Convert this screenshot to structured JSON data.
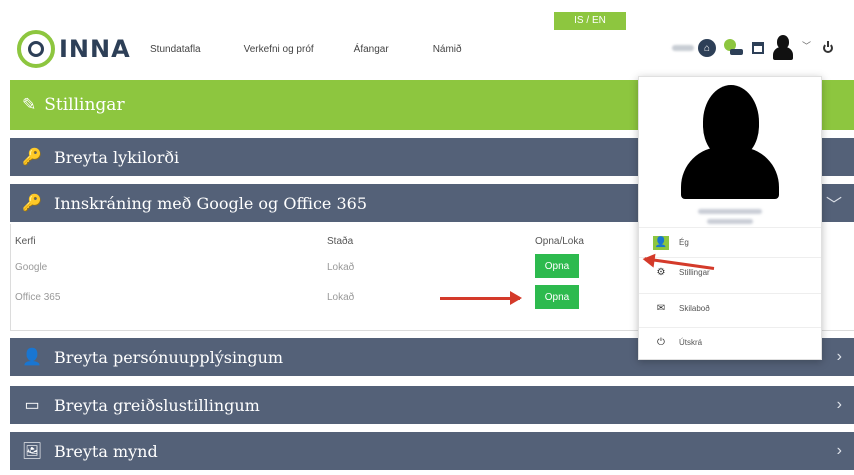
{
  "header": {
    "lang_toggle": "IS / EN",
    "logo_text": "INNA",
    "nav": [
      "Stundatafla",
      "Verkefni og próf",
      "Áfangar",
      "Námið"
    ],
    "message_badge": "0"
  },
  "settings_title": "Stillingar",
  "panels": {
    "change_password": "Breyta lykilorði",
    "google_office": "Innskráning með Google og Office 365",
    "personal_info": "Breyta persónuupplýsingum",
    "payment_settings": "Breyta greiðslustillingum",
    "change_picture": "Breyta mynd"
  },
  "table": {
    "headers": [
      "Kerfi",
      "Staða",
      "Opna/Loka"
    ],
    "rows": [
      {
        "system": "Google",
        "status": "Lokað",
        "action": "Opna"
      },
      {
        "system": "Office 365",
        "status": "Lokað",
        "action": "Opna"
      }
    ]
  },
  "dropdown": {
    "items": [
      "Ég",
      "Stillingar",
      "Skilaboð",
      "Útskrá"
    ]
  },
  "colors": {
    "green_accent": "#8dc63f",
    "panel_slate": "#546178",
    "button_green": "#2dba4e",
    "arrow_red": "#d43a2a",
    "navy": "#2d3f57"
  },
  "icons": {
    "settings_bar": "pencil-leaf-icon",
    "password": "key-icon",
    "google_office": "key-icon",
    "personal_info": "person-icon",
    "payment": "credit-card-icon",
    "picture": "picture-icon",
    "header": [
      "home-icon",
      "messages-icon",
      "calendar-icon",
      "user-icon",
      "chevron-down-icon",
      "power-icon"
    ],
    "dropdown": [
      "person-icon",
      "gear-icon",
      "envelope-icon",
      "power-icon"
    ]
  }
}
